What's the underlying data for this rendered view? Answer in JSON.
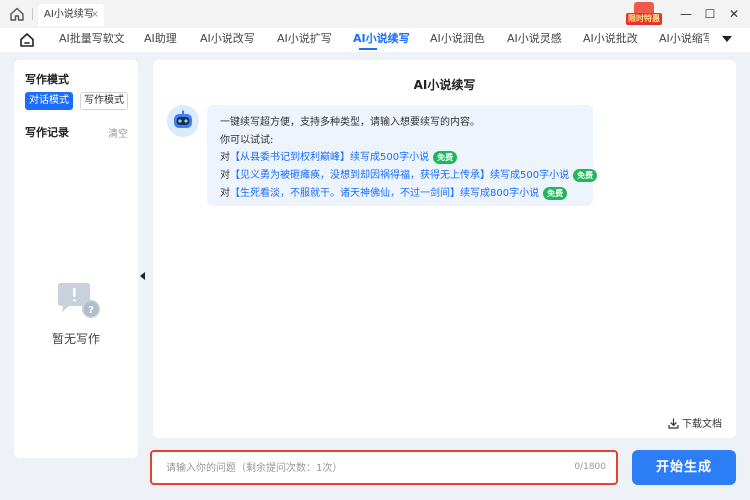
{
  "window": {
    "tab_title": "AI小说续写",
    "tab_close": "×",
    "promo_label": "限时特惠",
    "minimize": "—",
    "maximize": "☐",
    "close": "✕"
  },
  "nav": {
    "items": [
      {
        "label": "AI批量写软文"
      },
      {
        "label": "AI助理"
      },
      {
        "label": "AI小说改写"
      },
      {
        "label": "AI小说扩写"
      },
      {
        "label": "AI小说续写",
        "active": true
      },
      {
        "label": "AI小说润色"
      },
      {
        "label": "AI小说灵感"
      },
      {
        "label": "AI小说批改"
      },
      {
        "label": "AI小说缩写"
      }
    ],
    "more_icon": "caret-down-icon"
  },
  "sidebar": {
    "mode_title": "写作模式",
    "modes": [
      "对话模式",
      "写作模式"
    ],
    "record_title": "写作记录",
    "clear_label": "清空",
    "empty_text": "暂无写作"
  },
  "main": {
    "title": "AI小说续写",
    "intro": "一键续写超方便，支持多种类型，请输入想要续写的内容。",
    "try_label": "你可以试试:",
    "examples": [
      {
        "prefix": "对",
        "link": "【从县委书记到权利巅峰】",
        "suffix": "续写成500字小说",
        "badge": "免费"
      },
      {
        "prefix": "对",
        "link": "【见义勇为被砸瘫痪，没想到却因祸得福，获得无上传承】",
        "suffix": "续写成500字小说",
        "badge": "免费"
      },
      {
        "prefix": "对",
        "link": "【生死看淡，不服就干。诸天神佛仙，不过一剑间】",
        "suffix": "续写成800字小说",
        "badge": "免费"
      }
    ],
    "download_label": "下载文档"
  },
  "input": {
    "placeholder": "请输入你的问题（剩余提问次数：1次）",
    "counter": "0/1800"
  },
  "start_button": "开始生成",
  "colors": {
    "accent": "#1a6dff",
    "free_badge": "#1fb75b",
    "input_border": "#e5432e",
    "start_button": "#2d7df6"
  }
}
